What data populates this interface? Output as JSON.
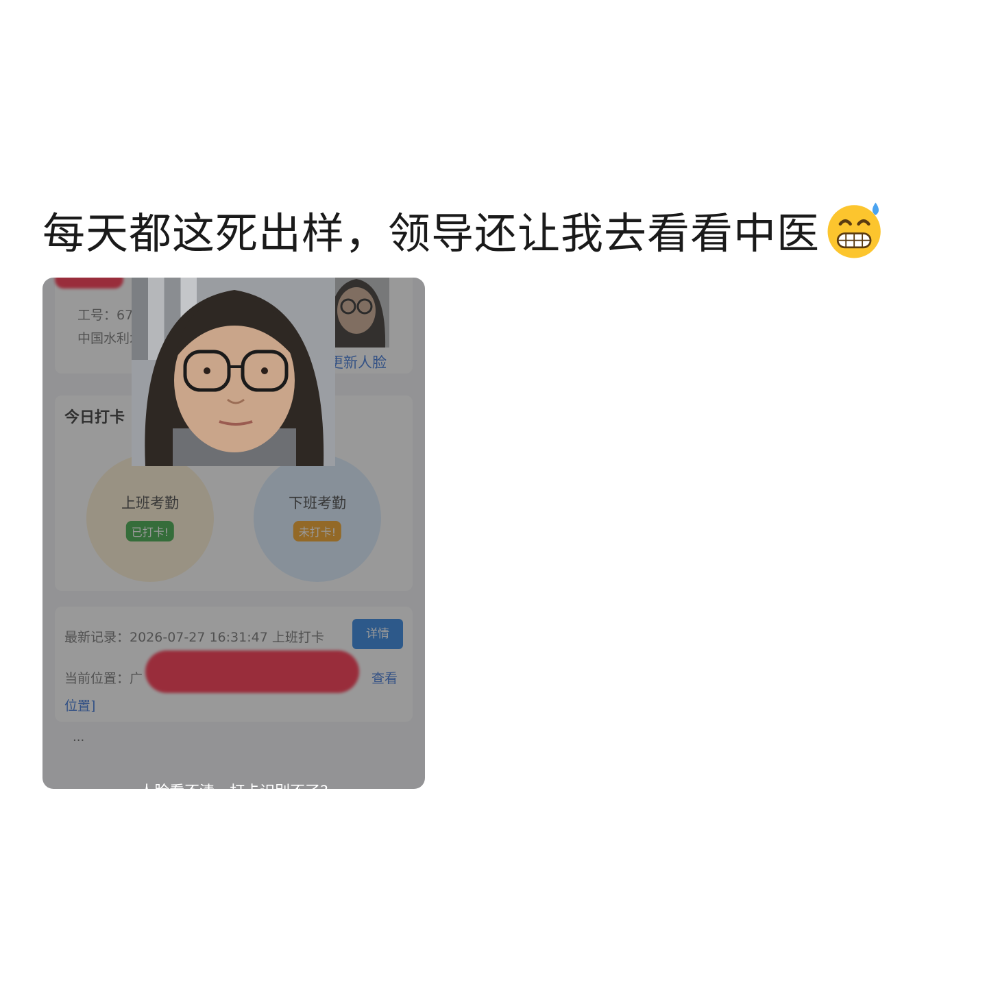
{
  "post": {
    "caption": "每天都这死出样，领导还让我去看看中医",
    "emoji": "grimacing-sweat-emoji"
  },
  "screenshot": {
    "profile": {
      "employee_id": "工号：672",
      "organization": "中国水利水",
      "update_face_label": "更新人脸"
    },
    "today": {
      "title": "今日打卡",
      "clock_in_label": "上班考勤",
      "clock_in_status": "已打卡!",
      "clock_out_label": "下班考勤",
      "clock_out_status": "未打卡!"
    },
    "record": {
      "latest_record": "最新记录：2026-07-27 16:31:47 上班打卡",
      "details_button": "详情",
      "location_prefix": "当前位置：广",
      "view_location_a": "查看",
      "view_location_b": "位置]"
    },
    "ellipsis": "...",
    "bottom_caption": "人脸看不清，打卡识别不了?"
  },
  "colors": {
    "clock_in_circle": "#fff1d2",
    "clock_out_circle": "#d9ecff",
    "done_badge": "#2ea43a",
    "pending_badge": "#f39c12",
    "button_blue": "#1f7ae0",
    "redaction": "#ff1f3c"
  }
}
